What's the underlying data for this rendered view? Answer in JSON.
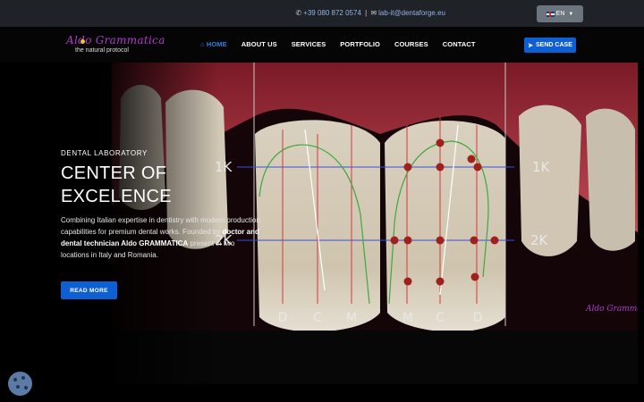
{
  "topbar": {
    "phone": "+39 080 872 0574",
    "separator": "|",
    "email": "lab-it@dentaforge.eu",
    "lang_label": "EN"
  },
  "nav": {
    "logo_script": "Aldo Grammatica",
    "logo_tagline": "the natural protocol",
    "items": [
      {
        "label": "HOME"
      },
      {
        "label": "ABOUT US"
      },
      {
        "label": "SERVICES"
      },
      {
        "label": "PORTFOLIO"
      },
      {
        "label": "COURSES"
      },
      {
        "label": "CONTACT"
      }
    ],
    "cta_label": "SEND CASE"
  },
  "hero": {
    "eyebrow": "DENTAL LABORATORY",
    "title": "CENTER OF EXCELENCE",
    "desc_1": "Combining Italian expertise in dentistry with modern production capabilities for premium dental works. Founded by ",
    "desc_bold_1": "doctor and dental technician Aldo GRAMMATICA",
    "desc_2": " present in two locations in Italy and Romania.",
    "button_label": "READ MORE"
  },
  "photo_labels": {
    "row_top_left": "1K",
    "row_top_right": "1K",
    "row_bottom_left": "2K",
    "row_bottom_right": "2K",
    "columns": [
      "D",
      "C",
      "M",
      "M",
      "C",
      "D"
    ],
    "watermark": "Aldo Grammatica"
  },
  "colors": {
    "accent": "#0f5fd4",
    "active_nav": "#2f7de1",
    "topbar_bg": "#1f2226"
  }
}
